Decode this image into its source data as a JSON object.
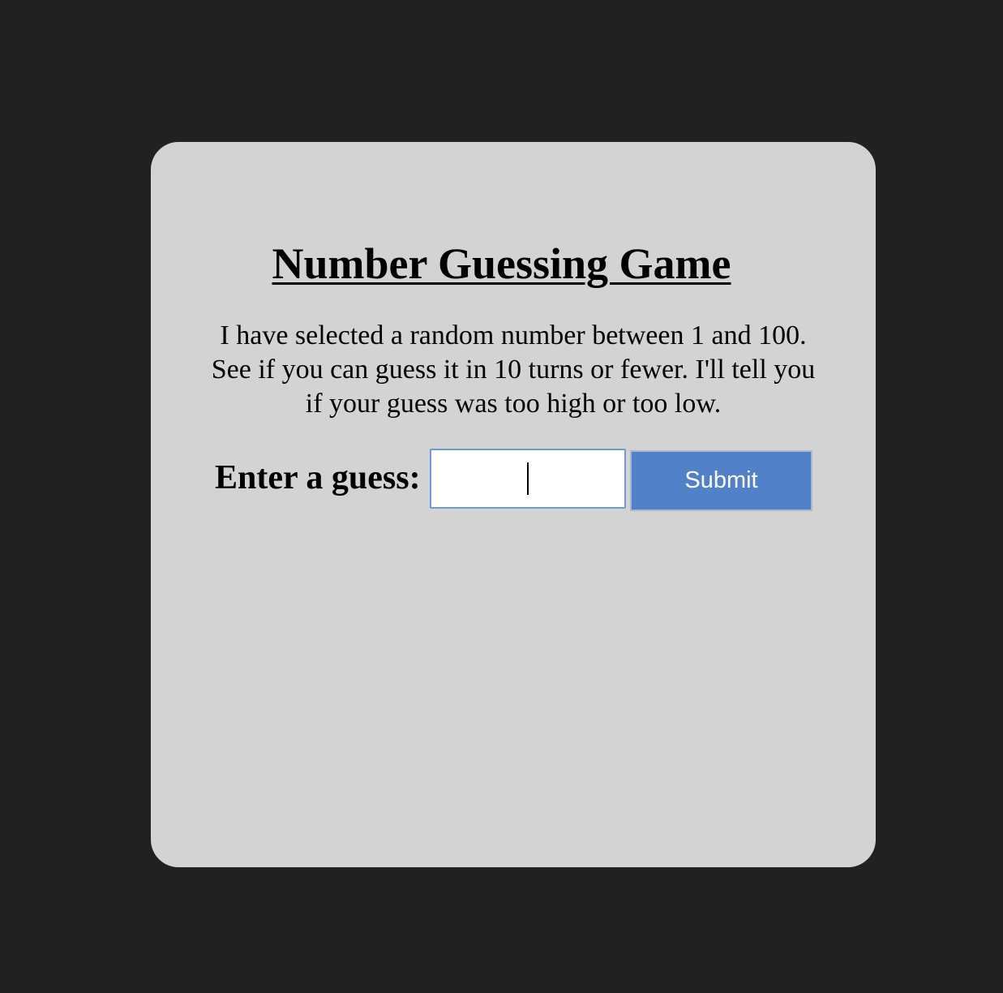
{
  "game": {
    "title": "Number Guessing Game",
    "description": "I have selected a random number between 1 and 100. See if you can guess it in 10 turns or fewer. I'll tell you if your guess was too high or too low.",
    "guess_label": "Enter a guess:",
    "guess_value": "",
    "submit_label": "Submit"
  },
  "colors": {
    "page_background": "#212121",
    "card_background": "#d3d3d3",
    "submit_button": "#5181c8",
    "input_border": "#6f9ad6"
  }
}
